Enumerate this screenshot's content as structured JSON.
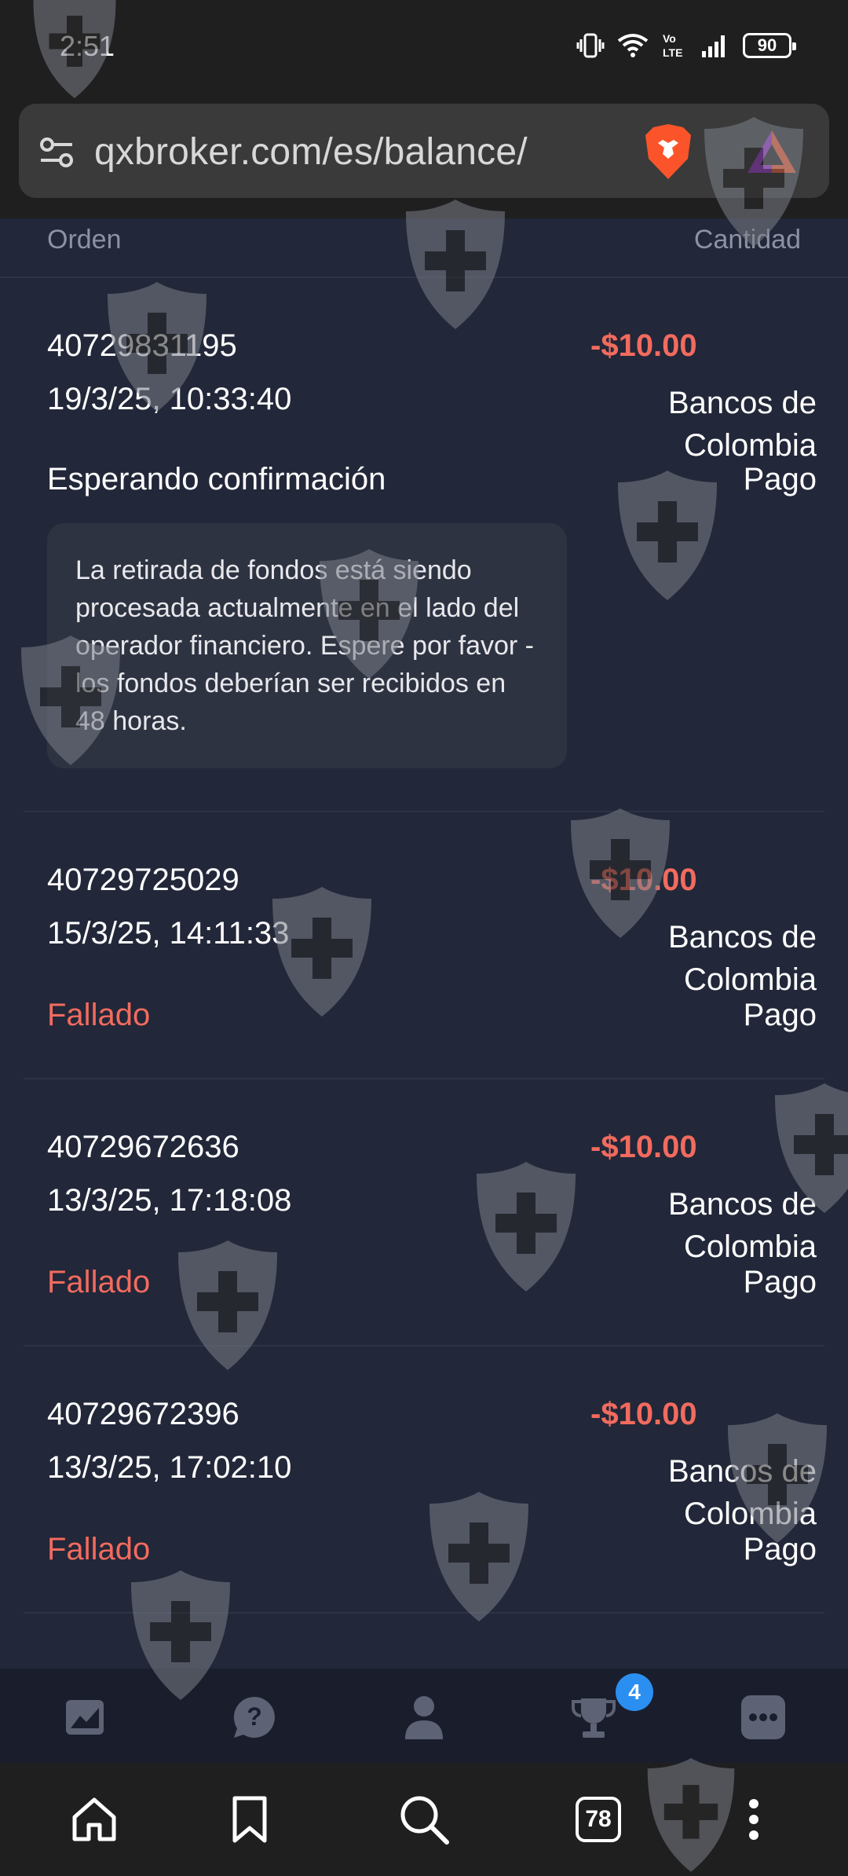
{
  "status_bar": {
    "time": "2:51",
    "battery": "90",
    "network_label": "Vo LTE"
  },
  "browser": {
    "url": "qxbroker.com/es/balance/",
    "tab_count": "78",
    "brand_color": "#fb542b"
  },
  "table": {
    "header_order": "Orden",
    "header_amount": "Cantidad"
  },
  "transactions": [
    {
      "id": "40729831195",
      "datetime": "19/3/25, 10:33:40",
      "amount": "-$10.00",
      "method_line1": "Bancos de",
      "method_line2": "Colombia",
      "status": "Esperando confirmación",
      "type": "Pago",
      "note": "La retirada de fondos está siendo procesada actualmente en el lado del operador financiero. Espere por favor - los fondos deberían ser recibidos en 48 horas."
    },
    {
      "id": "40729725029",
      "datetime": "15/3/25, 14:11:33",
      "amount": "-$10.00",
      "method_line1": "Bancos de",
      "method_line2": "Colombia",
      "status": "Fallado",
      "type": "Pago"
    },
    {
      "id": "40729672636",
      "datetime": "13/3/25, 17:18:08",
      "amount": "-$10.00",
      "method_line1": "Bancos de",
      "method_line2": "Colombia",
      "status": "Fallado",
      "type": "Pago"
    },
    {
      "id": "40729672396",
      "datetime": "13/3/25, 17:02:10",
      "amount": "-$10.00",
      "method_line1": "Bancos de",
      "method_line2": "Colombia",
      "status": "Fallado",
      "type": "Pago"
    }
  ],
  "app_nav": {
    "items": [
      "chart-icon",
      "help-icon",
      "user-icon",
      "trophy-icon",
      "more-icon"
    ],
    "trophy_badge": "4"
  },
  "browser_nav": {
    "items": [
      "home-icon",
      "bookmark-icon",
      "search-icon",
      "tabs-icon",
      "menu-icon"
    ]
  },
  "colors": {
    "background": "#222739",
    "negative": "#f26b5e",
    "muted": "#8d92a3",
    "badge": "#2b8ff2"
  }
}
